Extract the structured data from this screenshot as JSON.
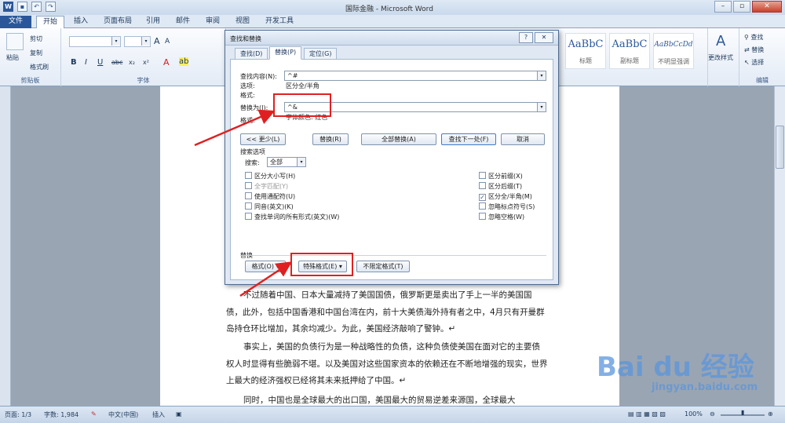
{
  "titlebar": {
    "title": "国际金融 - Microsoft Word",
    "logo": "W",
    "quick_access": [
      "save-icon",
      "undo-icon",
      "redo-icon"
    ]
  },
  "ribbon_tabs": [
    "文件",
    "开始",
    "插入",
    "页面布局",
    "引用",
    "邮件",
    "审阅",
    "视图",
    "开发工具"
  ],
  "ribbon": {
    "clipboard": {
      "paste": "粘贴",
      "cut": "剪切",
      "copy": "复制",
      "format_painter": "格式刷",
      "label": "剪贴板"
    },
    "font": {
      "label": "字体",
      "bold": "B",
      "italic": "I",
      "underline": "U",
      "strike": "abc",
      "sub": "x₂",
      "sup": "x²",
      "grow": "A",
      "shrink": "A"
    },
    "styles": [
      {
        "sample": "AaBbC",
        "name": "标题"
      },
      {
        "sample": "AaBbC",
        "name": "副标题"
      },
      {
        "sample": "AaBbCcDd",
        "name": "不明显强调"
      }
    ],
    "change_styles": "更改样式",
    "editing": {
      "find": "查找",
      "replace": "替换",
      "select": "选择",
      "label": "编辑"
    }
  },
  "dialog": {
    "title": "查找和替换",
    "help": "?",
    "close": "✕",
    "tabs": [
      "查找(D)",
      "替换(P)",
      "定位(G)"
    ],
    "find_label": "查找内容(N):",
    "find_value": "^#",
    "options_label": "选项:",
    "options_value": "区分全/半角",
    "format_label": "格式:",
    "replace_label": "替换为(I):",
    "replace_value": "^&",
    "replace_format_label": "格式:",
    "replace_format_value": "字体颜色: 红色",
    "less_button": "<< 更少(L)",
    "replace_button": "替换(R)",
    "replace_all_button": "全部替换(A)",
    "find_next_button": "查找下一处(F)",
    "cancel_button": "取消",
    "search_options_label": "搜索选项",
    "search_label": "搜索:",
    "search_value": "全部",
    "checks_left": [
      {
        "label": "区分大小写(H)",
        "checked": false,
        "disabled": false
      },
      {
        "label": "全字匹配(Y)",
        "checked": false,
        "disabled": true
      },
      {
        "label": "使用通配符(U)",
        "checked": false,
        "disabled": false
      },
      {
        "label": "同音(英文)(K)",
        "checked": false,
        "disabled": false
      },
      {
        "label": "查找单词的所有形式(英文)(W)",
        "checked": false,
        "disabled": false
      }
    ],
    "checks_right": [
      {
        "label": "区分前缀(X)",
        "checked": false
      },
      {
        "label": "区分后缀(T)",
        "checked": false
      },
      {
        "label": "区分全/半角(M)",
        "checked": true
      },
      {
        "label": "忽略标点符号(S)",
        "checked": false
      },
      {
        "label": "忽略空格(W)",
        "checked": false
      }
    ],
    "replace_section_label": "替换",
    "format_button": "格式(O) ▾",
    "special_button": "特殊格式(E) ▾",
    "no_format_button": "不限定格式(T)"
  },
  "document": {
    "paragraphs": [
      "不过随着中国、日本大量减持了美国国债，俄罗斯更是卖出了手上一半的美国国债，此外，包括中国香港和中国台湾在内，前十大美债海外持有者之中，4月只有开曼群岛持仓环比增加，其余均减少。为此，美国经济敲响了警钟。↵",
      "事实上，美国的负债行为是一种战略性的负债，这种负债使美国在面对它的主要债权人时显得有些脆弱不堪。以及美国对这些国家资本的依赖还在不断地增强的现实，世界上最大的经济强权已经将其未来抵押给了中国。↵",
      "同时，中国也是全球最大的出口国，美国最大的贸易逆差来源国，全球最大"
    ]
  },
  "statusbar": {
    "page": "页面: 1/3",
    "words": "字数: 1,984",
    "language": "中文(中国)",
    "mode": "插入",
    "zoom": "100%"
  },
  "watermark": {
    "main": "Bai du 经验",
    "sub": "jingyan.baidu.com"
  },
  "colors": {
    "accent": "#2b579a",
    "highlight": "#e02020"
  }
}
